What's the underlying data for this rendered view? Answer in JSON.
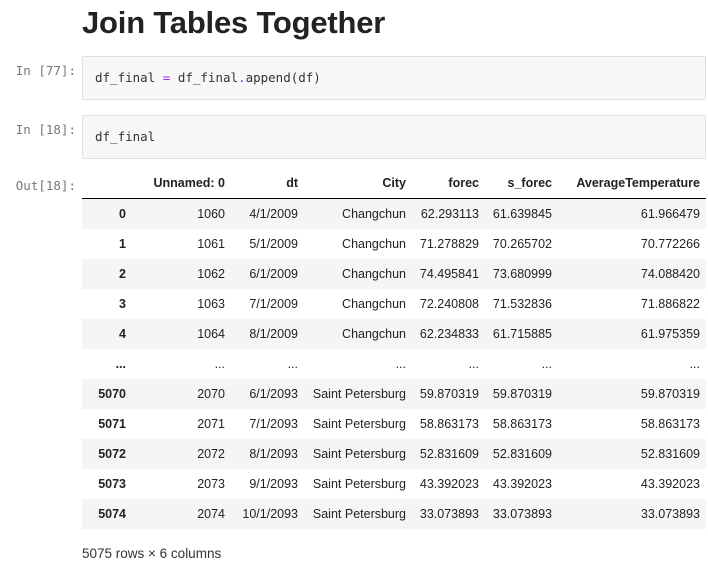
{
  "heading": "Join Tables Together",
  "cells": [
    {
      "prompt": "In [77]:",
      "code_var": "df_final",
      "code_op": "=",
      "code_obj": "df_final",
      "code_method": "append(df)"
    },
    {
      "prompt": "In [18]:",
      "code": "df_final"
    }
  ],
  "output": {
    "prompt": "Out[18]:",
    "columns": [
      "",
      "Unnamed: 0",
      "dt",
      "City",
      "forec",
      "s_forec",
      "AverageTemperature"
    ],
    "rows": [
      [
        "0",
        "1060",
        "4/1/2009",
        "Changchun",
        "62.293113",
        "61.639845",
        "61.966479"
      ],
      [
        "1",
        "1061",
        "5/1/2009",
        "Changchun",
        "71.278829",
        "70.265702",
        "70.772266"
      ],
      [
        "2",
        "1062",
        "6/1/2009",
        "Changchun",
        "74.495841",
        "73.680999",
        "74.088420"
      ],
      [
        "3",
        "1063",
        "7/1/2009",
        "Changchun",
        "72.240808",
        "71.532836",
        "71.886822"
      ],
      [
        "4",
        "1064",
        "8/1/2009",
        "Changchun",
        "62.234833",
        "61.715885",
        "61.975359"
      ],
      [
        "...",
        "...",
        "...",
        "...",
        "...",
        "...",
        "..."
      ],
      [
        "5070",
        "2070",
        "6/1/2093",
        "Saint Petersburg",
        "59.870319",
        "59.870319",
        "59.870319"
      ],
      [
        "5071",
        "2071",
        "7/1/2093",
        "Saint Petersburg",
        "58.863173",
        "58.863173",
        "58.863173"
      ],
      [
        "5072",
        "2072",
        "8/1/2093",
        "Saint Petersburg",
        "52.831609",
        "52.831609",
        "52.831609"
      ],
      [
        "5073",
        "2073",
        "9/1/2093",
        "Saint Petersburg",
        "43.392023",
        "43.392023",
        "43.392023"
      ],
      [
        "5074",
        "2074",
        "10/1/2093",
        "Saint Petersburg",
        "33.073893",
        "33.073893",
        "33.073893"
      ]
    ],
    "shape": "5075 rows × 6 columns"
  }
}
